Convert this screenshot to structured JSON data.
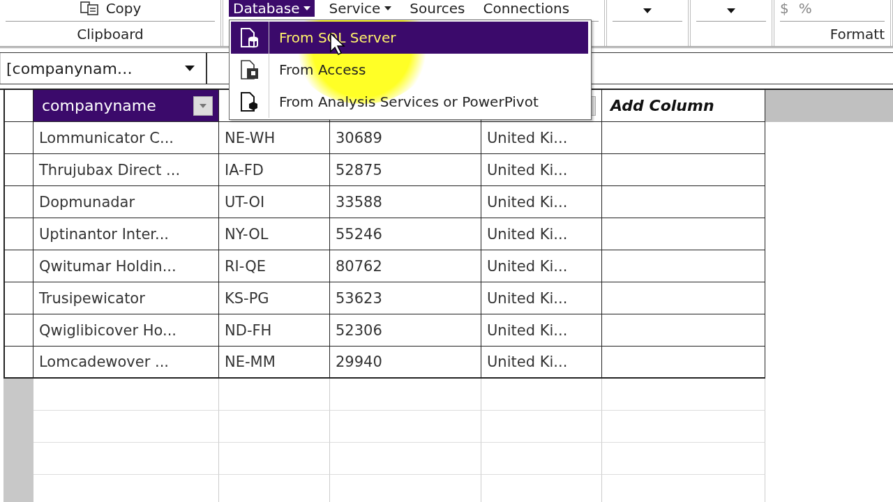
{
  "ribbon": {
    "groups": [
      {
        "kind": "clipboard",
        "buttons": [
          {
            "label": "Copy"
          }
        ],
        "label": "Clipboard"
      },
      {
        "kind": "external",
        "buttons": [
          {
            "label": "Database",
            "dropdown": true,
            "selected": true
          },
          {
            "label": "Service",
            "dropdown": true,
            "selected": false
          },
          {
            "label": "Sources",
            "dropdown": false,
            "selected": false
          },
          {
            "label": "Connections",
            "dropdown": false,
            "selected": false
          }
        ]
      },
      {
        "kind": "dropdown"
      },
      {
        "kind": "dropdown"
      },
      {
        "kind": "formatting",
        "symbols": [
          "$",
          "%"
        ],
        "label": "Formatt"
      }
    ]
  },
  "name_box": {
    "value": "[companynam…"
  },
  "menu": {
    "items": [
      {
        "label": "From SQL Server",
        "selected": true
      },
      {
        "label": "From Access",
        "selected": false
      },
      {
        "label": "From Analysis Services or PowerPivot",
        "selected": false
      }
    ]
  },
  "table": {
    "columns": [
      {
        "label": "companyname",
        "filter": true,
        "selected": true,
        "kind": "data"
      },
      {
        "kind": "hidden"
      },
      {
        "kind": "hidden"
      },
      {
        "kind": "hidden",
        "filter": true
      },
      {
        "label": "Add Column",
        "kind": "add"
      }
    ],
    "rows": [
      [
        "Lommunicator  C...",
        "NE-WH",
        "30689",
        "United Ki..."
      ],
      [
        "Thrujubax Direct ...",
        "IA-FD",
        "52875",
        "United Ki..."
      ],
      [
        "Dopmunadar",
        "UT-OI",
        "33588",
        "United Ki..."
      ],
      [
        "Uptinantor Inter...",
        "NY-OL",
        "55246",
        "United Ki..."
      ],
      [
        "Qwitumar Holdin...",
        "RI-QE",
        "80762",
        "United Ki..."
      ],
      [
        "Trusipewicator",
        "KS-PG",
        "53623",
        "United Ki..."
      ],
      [
        "Qwiglibicover Ho...",
        "ND-FH",
        "52306",
        "United Ki..."
      ],
      [
        "Lomcadewover ...",
        "NE-MM",
        "29940",
        "United Ki..."
      ]
    ]
  }
}
